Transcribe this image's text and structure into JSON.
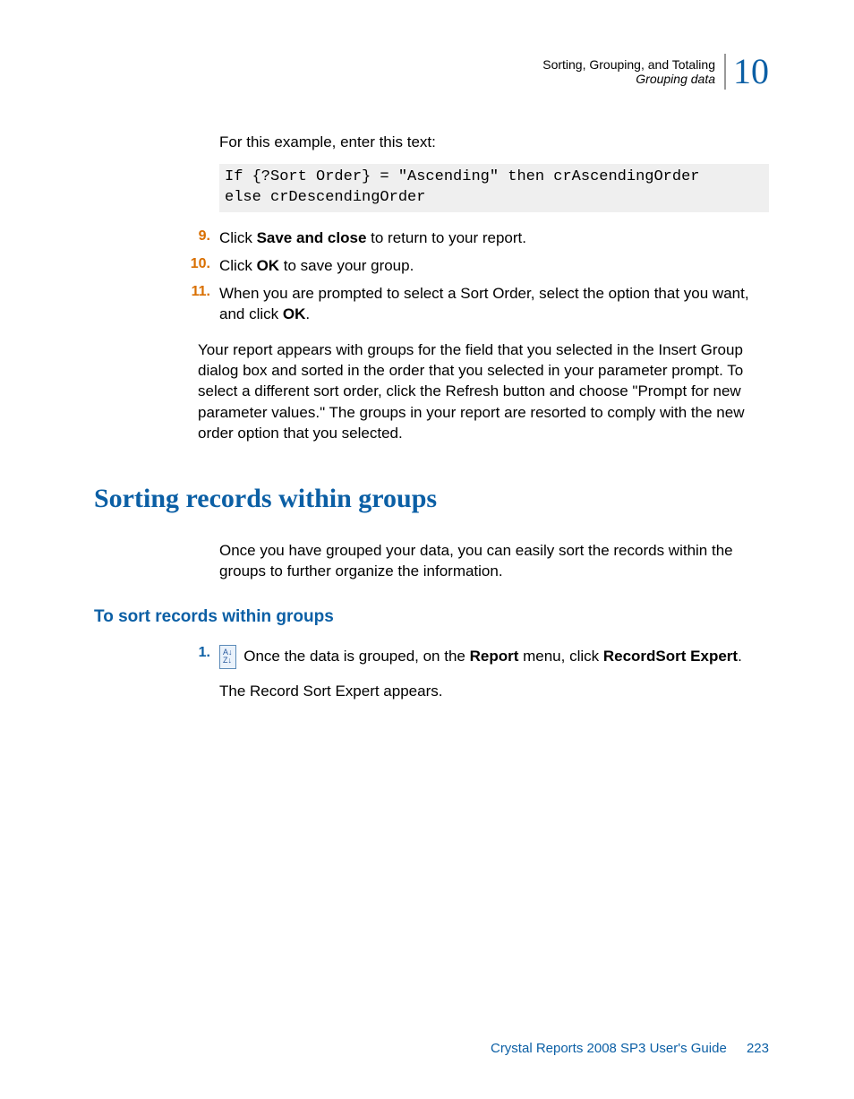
{
  "header": {
    "title": "Sorting, Grouping, and Totaling",
    "subtitle": "Grouping data",
    "chapter": "10"
  },
  "intro": "For this example, enter this text:",
  "code": "If {?Sort Order} = \"Ascending\" then crAscendingOrder\nelse crDescendingOrder",
  "steps": {
    "s9num": "9.",
    "s9a": "Click ",
    "s9b": "Save and close",
    "s9c": " to return to your report.",
    "s10num": "10.",
    "s10a": "Click ",
    "s10b": "OK",
    "s10c": " to save your group.",
    "s11num": "11.",
    "s11a": "When you are prompted to select a Sort Order, select the option that you want, and click ",
    "s11b": "OK",
    "s11c": "."
  },
  "resultPara": "Your report appears with groups for the field that you selected in the Insert Group dialog box and sorted in the order that you selected in your parameter prompt. To select a different sort order, click the Refresh button and choose \"Prompt for new parameter values.\" The groups in your report are resorted to comply with the new order option that you selected.",
  "h2": "Sorting records within groups",
  "h2body": "Once you have grouped your data, you can easily sort the records within the groups to further organize the information.",
  "h3": "To sort records within groups",
  "step1": {
    "num": "1.",
    "a": " Once the data is grouped, on the ",
    "b": "Report",
    "c": " menu, click ",
    "d": "RecordSort Expert",
    "e": "."
  },
  "step1after": "The Record Sort Expert appears.",
  "footer": {
    "book": "Crystal Reports 2008 SP3 User's Guide",
    "page": "223"
  },
  "iconGlyph": "A↓\nZ↓"
}
